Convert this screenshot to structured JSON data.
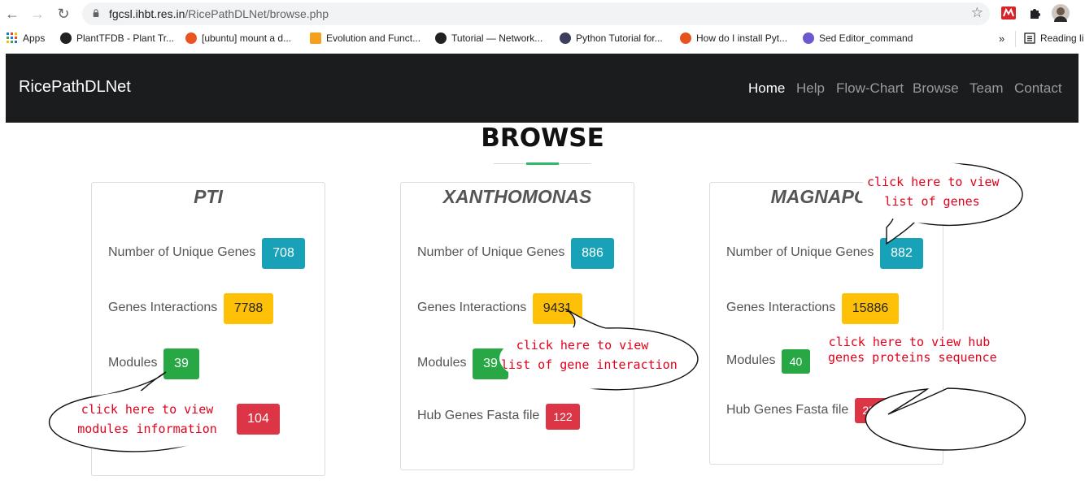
{
  "browser": {
    "url_domain": "fgcsl.ihbt.res.in",
    "url_path": "/RicePathDLNet/browse.php",
    "bookmarks": [
      {
        "label": "Apps"
      },
      {
        "label": "PlantTFDB - Plant Tr..."
      },
      {
        "label": "[ubuntu] mount a d..."
      },
      {
        "label": "Evolution and Funct..."
      },
      {
        "label": "Tutorial — Network..."
      },
      {
        "label": "Python Tutorial for..."
      },
      {
        "label": "How do I install Pyt..."
      },
      {
        "label": "Sed Editor_command"
      },
      {
        "label": "Reading li"
      }
    ]
  },
  "navbar": {
    "brand": "RicePathDLNet",
    "items": [
      "Home",
      "Help",
      "Flow-Chart",
      "Browse",
      "Team",
      "Contact"
    ],
    "active": "Home"
  },
  "page": {
    "title": "BROWSE",
    "accent_color": "#2fb86b"
  },
  "cards": [
    {
      "title": "PTI",
      "unique_genes_label": "Number of Unique Genes",
      "unique_genes": "708",
      "interactions_label": "Genes Interactions",
      "interactions": "7788",
      "modules_label": "Modules",
      "modules": "39",
      "hub_label": "",
      "hub": "104"
    },
    {
      "title": "XANTHOMONAS",
      "unique_genes_label": "Number of Unique Genes",
      "unique_genes": "886",
      "interactions_label": "Genes Interactions",
      "interactions": "9431",
      "modules_label": "Modules",
      "modules": "39",
      "hub_label": "Hub Genes Fasta file",
      "hub": "122"
    },
    {
      "title": "MAGNAPOR",
      "unique_genes_label": "Number of Unique Genes",
      "unique_genes": "882",
      "interactions_label": "Genes Interactions",
      "interactions": "15886",
      "modules_label": "Modules",
      "modules": "40",
      "hub_label": "Hub Genes Fasta file",
      "hub": "252"
    }
  ],
  "callouts": {
    "genes": [
      "click here to view",
      "list of genes"
    ],
    "interaction": [
      "click here to view",
      "list of gene interaction"
    ],
    "modules": [
      "click here to view",
      "modules information"
    ],
    "hub": [
      "click here to view hub",
      "genes proteins sequence"
    ]
  },
  "colors": {
    "info": "#17a2b8",
    "warning": "#ffc107",
    "success": "#28a745",
    "danger": "#dc3545",
    "callout_text": "#e3001b"
  }
}
